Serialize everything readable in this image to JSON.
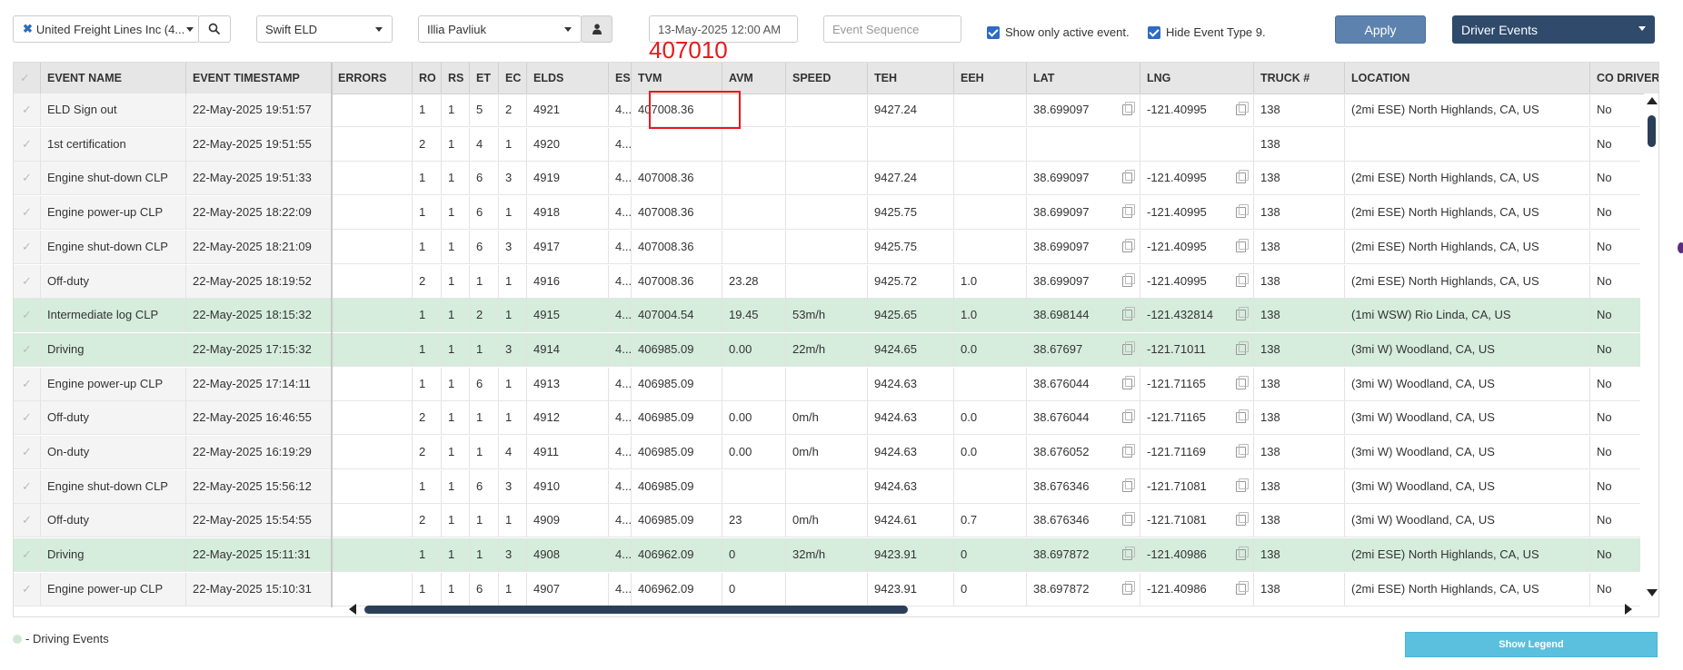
{
  "toolbar": {
    "company": "United Freight Lines Inc (4...",
    "eld": "Swift ELD",
    "driver": "Illia Pavliuk",
    "date": "13-May-2025 12:00 AM",
    "event_sequence_placeholder": "Event Sequence",
    "show_only_active": "Show only active event.",
    "hide_event_type": "Hide Event Type 9.",
    "apply": "Apply",
    "events_dropdown": "Driver Events"
  },
  "annotation": "407010",
  "columns": [
    "EVENT NAME",
    "EVENT TIMESTAMP",
    "ERRORS",
    "RO",
    "RS",
    "ET",
    "EC",
    "ELDS",
    "ES",
    "TVM",
    "AVM",
    "SPEED",
    "TEH",
    "EEH",
    "LAT",
    "LNG",
    "TRUCK #",
    "LOCATION",
    "CO DRIVER"
  ],
  "rows": [
    {
      "name": "ELD Sign out",
      "ts": "22-May-2025 19:51:57",
      "errors": "",
      "ro": "1",
      "rs": "1",
      "et": "5",
      "ec": "2",
      "elds": "4921",
      "es": "4...",
      "tvm": "407008.36",
      "avm": "",
      "speed": "",
      "teh": "9427.24",
      "eeh": "",
      "lat": "38.699097",
      "lng": "-121.40995",
      "truck": "138",
      "loc": "(2mi ESE) North Highlands, CA, US",
      "co": "No",
      "driving": false
    },
    {
      "name": "1st certification",
      "ts": "22-May-2025 19:51:55",
      "errors": "",
      "ro": "2",
      "rs": "1",
      "et": "4",
      "ec": "1",
      "elds": "4920",
      "es": "4...",
      "tvm": "",
      "avm": "",
      "speed": "",
      "teh": "",
      "eeh": "",
      "lat": "",
      "lng": "",
      "truck": "138",
      "loc": "",
      "co": "No",
      "driving": false
    },
    {
      "name": "Engine shut-down CLP",
      "ts": "22-May-2025 19:51:33",
      "errors": "",
      "ro": "1",
      "rs": "1",
      "et": "6",
      "ec": "3",
      "elds": "4919",
      "es": "4...",
      "tvm": "407008.36",
      "avm": "",
      "speed": "",
      "teh": "9427.24",
      "eeh": "",
      "lat": "38.699097",
      "lng": "-121.40995",
      "truck": "138",
      "loc": "(2mi ESE) North Highlands, CA, US",
      "co": "No",
      "driving": false
    },
    {
      "name": "Engine power-up CLP",
      "ts": "22-May-2025 18:22:09",
      "errors": "",
      "ro": "1",
      "rs": "1",
      "et": "6",
      "ec": "1",
      "elds": "4918",
      "es": "4...",
      "tvm": "407008.36",
      "avm": "",
      "speed": "",
      "teh": "9425.75",
      "eeh": "",
      "lat": "38.699097",
      "lng": "-121.40995",
      "truck": "138",
      "loc": "(2mi ESE) North Highlands, CA, US",
      "co": "No",
      "driving": false
    },
    {
      "name": "Engine shut-down CLP",
      "ts": "22-May-2025 18:21:09",
      "errors": "",
      "ro": "1",
      "rs": "1",
      "et": "6",
      "ec": "3",
      "elds": "4917",
      "es": "4...",
      "tvm": "407008.36",
      "avm": "",
      "speed": "",
      "teh": "9425.75",
      "eeh": "",
      "lat": "38.699097",
      "lng": "-121.40995",
      "truck": "138",
      "loc": "(2mi ESE) North Highlands, CA, US",
      "co": "No",
      "driving": false
    },
    {
      "name": "Off-duty",
      "ts": "22-May-2025 18:19:52",
      "errors": "",
      "ro": "2",
      "rs": "1",
      "et": "1",
      "ec": "1",
      "elds": "4916",
      "es": "4...",
      "tvm": "407008.36",
      "avm": "23.28",
      "speed": "",
      "teh": "9425.72",
      "eeh": "1.0",
      "lat": "38.699097",
      "lng": "-121.40995",
      "truck": "138",
      "loc": "(2mi ESE) North Highlands, CA, US",
      "co": "No",
      "driving": false
    },
    {
      "name": "Intermediate log CLP",
      "ts": "22-May-2025 18:15:32",
      "errors": "",
      "ro": "1",
      "rs": "1",
      "et": "2",
      "ec": "1",
      "elds": "4915",
      "es": "4...",
      "tvm": "407004.54",
      "avm": "19.45",
      "speed": "53m/h",
      "teh": "9425.65",
      "eeh": "1.0",
      "lat": "38.698144",
      "lng": "-121.432814",
      "truck": "138",
      "loc": "(1mi WSW) Rio Linda, CA, US",
      "co": "No",
      "driving": true
    },
    {
      "name": "Driving",
      "ts": "22-May-2025 17:15:32",
      "errors": "",
      "ro": "1",
      "rs": "1",
      "et": "1",
      "ec": "3",
      "elds": "4914",
      "es": "4...",
      "tvm": "406985.09",
      "avm": "0.00",
      "speed": "22m/h",
      "teh": "9424.65",
      "eeh": "0.0",
      "lat": "38.67697",
      "lng": "-121.71011",
      "truck": "138",
      "loc": "(3mi W) Woodland, CA, US",
      "co": "No",
      "driving": true
    },
    {
      "name": "Engine power-up CLP",
      "ts": "22-May-2025 17:14:11",
      "errors": "",
      "ro": "1",
      "rs": "1",
      "et": "6",
      "ec": "1",
      "elds": "4913",
      "es": "4...",
      "tvm": "406985.09",
      "avm": "",
      "speed": "",
      "teh": "9424.63",
      "eeh": "",
      "lat": "38.676044",
      "lng": "-121.71165",
      "truck": "138",
      "loc": "(3mi W) Woodland, CA, US",
      "co": "No",
      "driving": false
    },
    {
      "name": "Off-duty",
      "ts": "22-May-2025 16:46:55",
      "errors": "",
      "ro": "2",
      "rs": "1",
      "et": "1",
      "ec": "1",
      "elds": "4912",
      "es": "4...",
      "tvm": "406985.09",
      "avm": "0.00",
      "speed": "0m/h",
      "teh": "9424.63",
      "eeh": "0.0",
      "lat": "38.676044",
      "lng": "-121.71165",
      "truck": "138",
      "loc": "(3mi W) Woodland, CA, US",
      "co": "No",
      "driving": false
    },
    {
      "name": "On-duty",
      "ts": "22-May-2025 16:19:29",
      "errors": "",
      "ro": "2",
      "rs": "1",
      "et": "1",
      "ec": "4",
      "elds": "4911",
      "es": "4...",
      "tvm": "406985.09",
      "avm": "0.00",
      "speed": "0m/h",
      "teh": "9424.63",
      "eeh": "0.0",
      "lat": "38.676052",
      "lng": "-121.71169",
      "truck": "138",
      "loc": "(3mi W) Woodland, CA, US",
      "co": "No",
      "driving": false
    },
    {
      "name": "Engine shut-down CLP",
      "ts": "22-May-2025 15:56:12",
      "errors": "",
      "ro": "1",
      "rs": "1",
      "et": "6",
      "ec": "3",
      "elds": "4910",
      "es": "4...",
      "tvm": "406985.09",
      "avm": "",
      "speed": "",
      "teh": "9424.63",
      "eeh": "",
      "lat": "38.676346",
      "lng": "-121.71081",
      "truck": "138",
      "loc": "(3mi W) Woodland, CA, US",
      "co": "No",
      "driving": false
    },
    {
      "name": "Off-duty",
      "ts": "22-May-2025 15:54:55",
      "errors": "",
      "ro": "2",
      "rs": "1",
      "et": "1",
      "ec": "1",
      "elds": "4909",
      "es": "4...",
      "tvm": "406985.09",
      "avm": "23",
      "speed": "0m/h",
      "teh": "9424.61",
      "eeh": "0.7",
      "lat": "38.676346",
      "lng": "-121.71081",
      "truck": "138",
      "loc": "(3mi W) Woodland, CA, US",
      "co": "No",
      "driving": false
    },
    {
      "name": "Driving",
      "ts": "22-May-2025 15:11:31",
      "errors": "",
      "ro": "1",
      "rs": "1",
      "et": "1",
      "ec": "3",
      "elds": "4908",
      "es": "4...",
      "tvm": "406962.09",
      "avm": "0",
      "speed": "32m/h",
      "teh": "9423.91",
      "eeh": "0",
      "lat": "38.697872",
      "lng": "-121.40986",
      "truck": "138",
      "loc": "(2mi ESE) North Highlands, CA, US",
      "co": "No",
      "driving": true
    },
    {
      "name": "Engine power-up CLP",
      "ts": "22-May-2025 15:10:31",
      "errors": "",
      "ro": "1",
      "rs": "1",
      "et": "6",
      "ec": "1",
      "elds": "4907",
      "es": "4...",
      "tvm": "406962.09",
      "avm": "0",
      "speed": "",
      "teh": "9423.91",
      "eeh": "0",
      "lat": "38.697872",
      "lng": "-121.40986",
      "truck": "138",
      "loc": "(2mi ESE) North Highlands, CA, US",
      "co": "No",
      "driving": false
    }
  ],
  "legend": {
    "label": "- Driving Events",
    "button": "Show Legend"
  },
  "colors": {
    "driving_row": "#d6ecdd",
    "apply": "#5d82ae",
    "dropdown": "#2f4a6b",
    "annotation": "#e8191b",
    "show_legend": "#5bc0de"
  }
}
